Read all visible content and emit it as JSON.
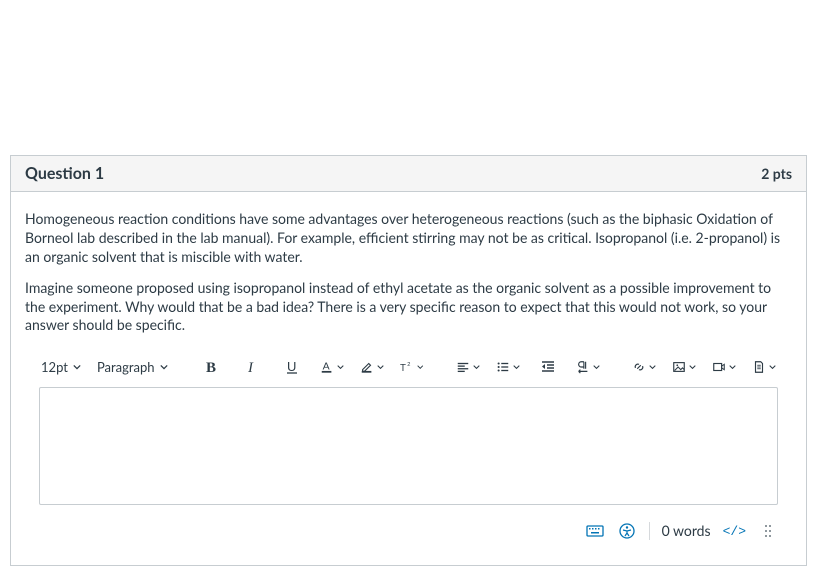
{
  "header": {
    "title": "Question 1",
    "points": "2 pts"
  },
  "body": {
    "p1": "Homogeneous reaction conditions have some advantages over heterogeneous reactions (such as the biphasic Oxidation of Borneol lab described in the lab manual). For example, efficient stirring may not be as critical. Isopropanol (i.e. 2-propanol) is an organic solvent that is miscible with water.",
    "p2": "Imagine someone proposed using isopropanol instead of ethyl acetate as the organic solvent as a possible improvement to the experiment. Why would that be a bad idea? There is a very specific reason to expect that this would not work, so your answer should be specific."
  },
  "toolbar": {
    "font_size": "12pt",
    "block": "Paragraph"
  },
  "status": {
    "words": "0 words",
    "code": "</>"
  }
}
